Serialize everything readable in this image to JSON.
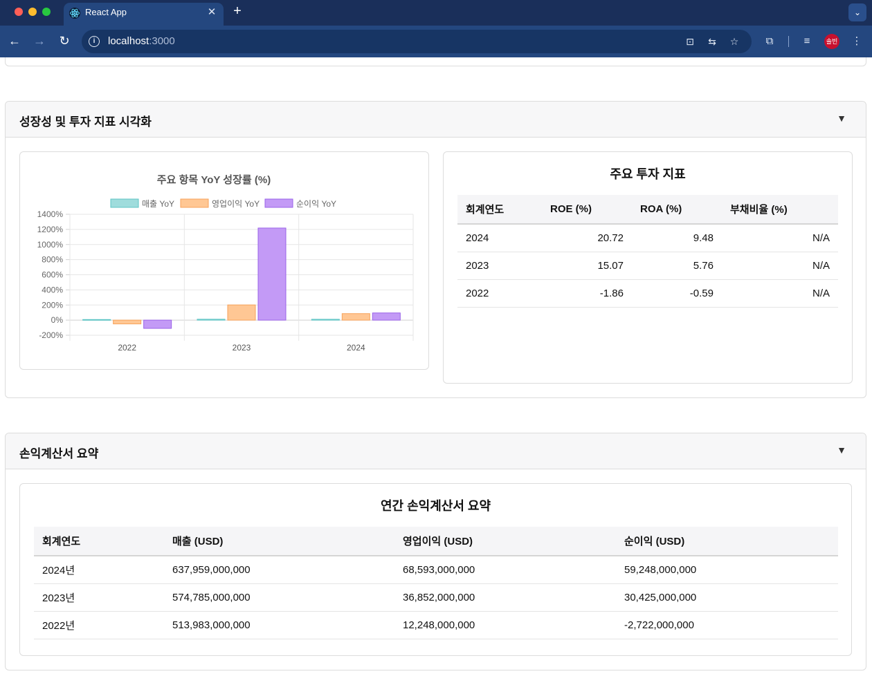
{
  "browser": {
    "tab_title": "React App",
    "url_host": "localhost",
    "url_port": ":3000",
    "avatar_text": "솔빈"
  },
  "growth_section": {
    "title": "성장성 및 투자 지표 시각화",
    "toggle": "▼",
    "chart_card": {
      "chart_data": {
        "type": "bar",
        "title": "주요 항목 YoY 성장률 (%)",
        "categories": [
          "2022",
          "2023",
          "2024"
        ],
        "series": [
          {
            "name": "매출 YoY",
            "values": [
              7.8,
              11.8,
              11.0
            ],
            "fill": "#9fdcdc",
            "stroke": "#5cc4c4"
          },
          {
            "name": "영업이익 YoY",
            "values": [
              -50,
              201,
              86
            ],
            "fill": "#ffc794",
            "stroke": "#f7a25a"
          },
          {
            "name": "순이익 YoY",
            "values": [
              -109,
              1218,
              95
            ],
            "fill": "#c39af6",
            "stroke": "#9a63e8"
          }
        ],
        "yticks": [
          "1400%",
          "1200%",
          "1000%",
          "800%",
          "600%",
          "400%",
          "200%",
          "0%",
          "-200%"
        ],
        "ylim": [
          -200,
          1400
        ],
        "grid": true,
        "legend": "top"
      }
    },
    "invest_card": {
      "title": "주요 투자 지표",
      "columns": [
        "회계연도",
        "ROE (%)",
        "ROA (%)",
        "부채비율 (%)"
      ],
      "rows": [
        [
          "2024",
          "20.72",
          "9.48",
          "N/A"
        ],
        [
          "2023",
          "15.07",
          "5.76",
          "N/A"
        ],
        [
          "2022",
          "-1.86",
          "-0.59",
          "N/A"
        ]
      ]
    }
  },
  "income_section": {
    "title": "손익계산서 요약",
    "toggle": "▼",
    "card_title": "연간 손익계산서 요약",
    "columns": [
      "회계연도",
      "매출 (USD)",
      "영업이익 (USD)",
      "순이익 (USD)"
    ],
    "rows": [
      [
        "2024년",
        "637,959,000,000",
        "68,593,000,000",
        "59,248,000,000"
      ],
      [
        "2023년",
        "574,785,000,000",
        "36,852,000,000",
        "30,425,000,000"
      ],
      [
        "2022년",
        "513,983,000,000",
        "12,248,000,000",
        "-2,722,000,000"
      ]
    ]
  }
}
